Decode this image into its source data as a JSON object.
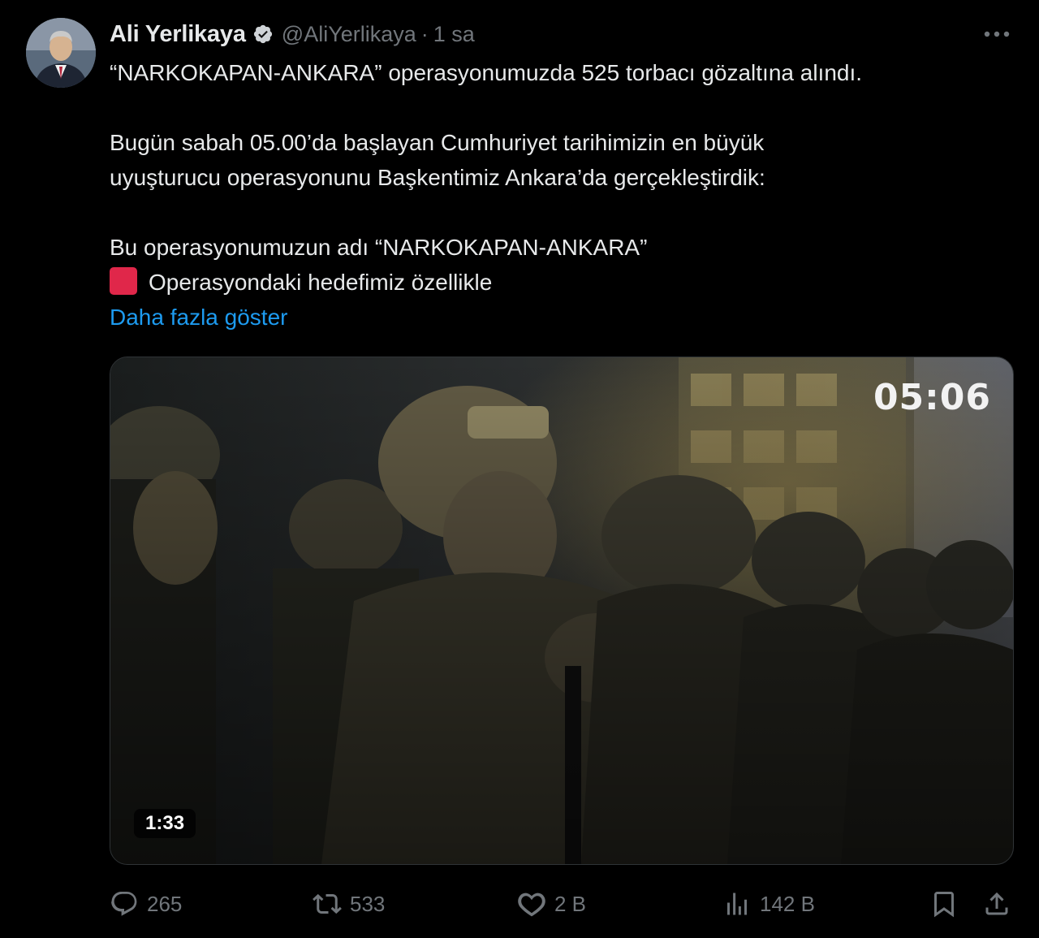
{
  "author": {
    "display_name": "Ali Yerlikaya",
    "handle": "@AliYerlikaya",
    "separator": "·",
    "time": "1 sa",
    "verified": true,
    "verified_color": "#1d9bf0"
  },
  "tweet": {
    "lines": [
      "“NARKOKAPAN-ANKARA” operasyonumuzda 525 torbacı gözaltına alındı.",
      "Bugün sabah 05.00’da başlayan Cumhuriyet tarihimizin en büyük",
      "uyuşturucu operasyonunu Başkentimiz Ankara’da gerçekleştirdik:",
      "Bu operasyonumuzun adı “NARKOKAPAN-ANKARA”",
      "Operasyondaki hedefimiz özellikle"
    ],
    "emoji_icon": "red-square-icon",
    "show_more": "Daha fazla göster",
    "link_color": "#1d9bf0"
  },
  "media": {
    "overlay_time": "05:06",
    "duration": "1:33"
  },
  "actions": {
    "reply_count": "265",
    "retweet_count": "533",
    "like_count": "2 B",
    "views_count": "142 B"
  }
}
